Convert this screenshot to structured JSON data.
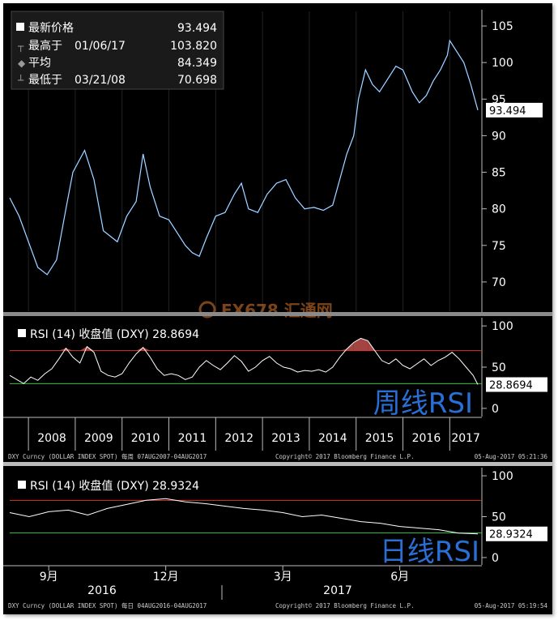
{
  "chart_data": [
    {
      "type": "line",
      "panel": "weekly-price",
      "legend": [
        {
          "label": "最新价格",
          "date": "",
          "value": "93.494"
        },
        {
          "label": "最高于",
          "date": "01/06/17",
          "value": "103.820"
        },
        {
          "label": "平均",
          "date": "",
          "value": "84.349"
        },
        {
          "label": "最低于",
          "date": "03/21/08",
          "value": "70.698"
        }
      ],
      "last_value_label": "93.494",
      "ylim": [
        66,
        107
      ],
      "yticks": [
        70,
        75,
        80,
        85,
        90,
        95,
        100,
        105
      ],
      "x": [
        2007.6,
        2007.8,
        2008.0,
        2008.2,
        2008.4,
        2008.6,
        2008.8,
        2008.95,
        2009.2,
        2009.4,
        2009.6,
        2009.9,
        2010.1,
        2010.3,
        2010.45,
        2010.6,
        2010.8,
        2011.0,
        2011.2,
        2011.35,
        2011.5,
        2011.65,
        2011.8,
        2012.0,
        2012.2,
        2012.4,
        2012.55,
        2012.7,
        2012.9,
        2013.1,
        2013.3,
        2013.5,
        2013.7,
        2013.9,
        2014.1,
        2014.3,
        2014.5,
        2014.65,
        2014.8,
        2014.95,
        2015.05,
        2015.2,
        2015.35,
        2015.5,
        2015.7,
        2015.85,
        2016.0,
        2016.2,
        2016.35,
        2016.5,
        2016.65,
        2016.8,
        2016.95,
        2017.0,
        2017.15,
        2017.3,
        2017.45,
        2017.6
      ],
      "series": [
        {
          "values": [
            81.5,
            79,
            75.5,
            72,
            71,
            73,
            80,
            85,
            88,
            84,
            77,
            75.5,
            79,
            81,
            87.5,
            83,
            79,
            78.5,
            76.5,
            75,
            74,
            73.5,
            76,
            79,
            79.5,
            82,
            83.5,
            80,
            79.5,
            82,
            83.5,
            84,
            81.5,
            80,
            80.2,
            79.8,
            80.5,
            84,
            87.5,
            90,
            95,
            99,
            97,
            96,
            98,
            99.5,
            99,
            96,
            94.5,
            95.5,
            97.5,
            99,
            101,
            103,
            101.5,
            100,
            97,
            93.494
          ]
        }
      ],
      "x_tick_labels": [
        "2008",
        "2009",
        "2010",
        "2011",
        "2012",
        "2013",
        "2014",
        "2015",
        "2016",
        "2017"
      ]
    },
    {
      "type": "line",
      "panel": "weekly-rsi",
      "legend": "RSI (14) 收盘值 (DXY) 28.8694",
      "last_value_label": "28.8694",
      "ylim": [
        -8,
        108
      ],
      "yticks": [
        0,
        50,
        100
      ],
      "reference_lines": [
        {
          "value": 70,
          "color": "#d23a2a"
        },
        {
          "value": 30,
          "color": "#35c443"
        }
      ],
      "x": [
        2007.6,
        2007.75,
        2007.9,
        2008.05,
        2008.2,
        2008.35,
        2008.5,
        2008.65,
        2008.8,
        2008.95,
        2009.1,
        2009.25,
        2009.4,
        2009.55,
        2009.7,
        2009.85,
        2010.0,
        2010.15,
        2010.3,
        2010.45,
        2010.6,
        2010.75,
        2010.9,
        2011.05,
        2011.2,
        2011.35,
        2011.5,
        2011.65,
        2011.8,
        2011.95,
        2012.1,
        2012.25,
        2012.4,
        2012.55,
        2012.7,
        2012.85,
        2013.0,
        2013.15,
        2013.3,
        2013.45,
        2013.6,
        2013.75,
        2013.9,
        2014.05,
        2014.2,
        2014.35,
        2014.5,
        2014.65,
        2014.8,
        2014.95,
        2015.1,
        2015.25,
        2015.4,
        2015.55,
        2015.7,
        2015.85,
        2016.0,
        2016.15,
        2016.3,
        2016.45,
        2016.6,
        2016.75,
        2016.9,
        2017.05,
        2017.2,
        2017.35,
        2017.5,
        2017.6
      ],
      "series": [
        {
          "values": [
            40,
            35,
            30,
            38,
            34,
            42,
            48,
            60,
            73,
            62,
            55,
            75,
            68,
            45,
            40,
            38,
            42,
            55,
            66,
            74,
            62,
            48,
            40,
            42,
            40,
            35,
            38,
            50,
            58,
            52,
            47,
            55,
            64,
            57,
            45,
            50,
            58,
            63,
            55,
            50,
            48,
            44,
            46,
            45,
            47,
            44,
            50,
            62,
            72,
            80,
            85,
            82,
            70,
            58,
            54,
            60,
            52,
            48,
            54,
            60,
            52,
            58,
            62,
            68,
            60,
            50,
            40,
            28.8694
          ]
        }
      ],
      "x_tick_labels": [
        "2008",
        "2009",
        "2010",
        "2011",
        "2012",
        "2013",
        "2014",
        "2015",
        "2016",
        "2017"
      ],
      "footer_left": "DXY Curncy (DOLLAR INDEX SPOT)  每周 07AUG2007-04AUG2017",
      "footer_center": "Copyright© 2017 Bloomberg Finance L.P.",
      "footer_right": "05-Aug-2017 05:21:36"
    },
    {
      "type": "line",
      "panel": "daily-rsi",
      "legend": "RSI (14) 收盘值 (DXY) 28.9324",
      "last_value_label": "28.9324",
      "ylim": [
        -8,
        108
      ],
      "yticks": [
        0,
        50,
        100
      ],
      "reference_lines": [
        {
          "value": 70,
          "color": "#d23a2a"
        },
        {
          "value": 30,
          "color": "#35c443"
        }
      ],
      "x": [
        0,
        0.5,
        1,
        1.5,
        2,
        2.5,
        3,
        3.5,
        4,
        4.5,
        5,
        5.5,
        6,
        6.5,
        7,
        7.5,
        8,
        8.5,
        9,
        9.5,
        10,
        10.5,
        11,
        11.5,
        12
      ],
      "series": [
        {
          "values": [
            55,
            50,
            56,
            58,
            52,
            60,
            65,
            70,
            72,
            68,
            66,
            63,
            60,
            58,
            55,
            50,
            52,
            48,
            44,
            42,
            38,
            36,
            34,
            30,
            28.9324
          ]
        }
      ],
      "x_tick_labels": [
        "9月",
        "12月",
        "3月",
        "6月"
      ],
      "year_labels": [
        "2016",
        "2017"
      ],
      "footer_left": "DXY Curncy (DOLLAR INDEX SPOT)  每日 04AUG2016-04AUG2017",
      "footer_center": "Copyright© 2017 Bloomberg Finance L.P.",
      "footer_right": "05-Aug-2017 05:19:54"
    }
  ],
  "annotations": {
    "weekly_rsi": "周线RSI",
    "daily_rsi": "日线RSI",
    "watermark": "FX678 汇通网"
  },
  "colors": {
    "background": "#000000",
    "price_line": "#3b8fe0",
    "rsi_line": "#ffffff",
    "overbought": "#d23a2a",
    "oversold": "#35c443",
    "annotation": "#2a6fd6",
    "rsi_fill": "#c0504d"
  }
}
